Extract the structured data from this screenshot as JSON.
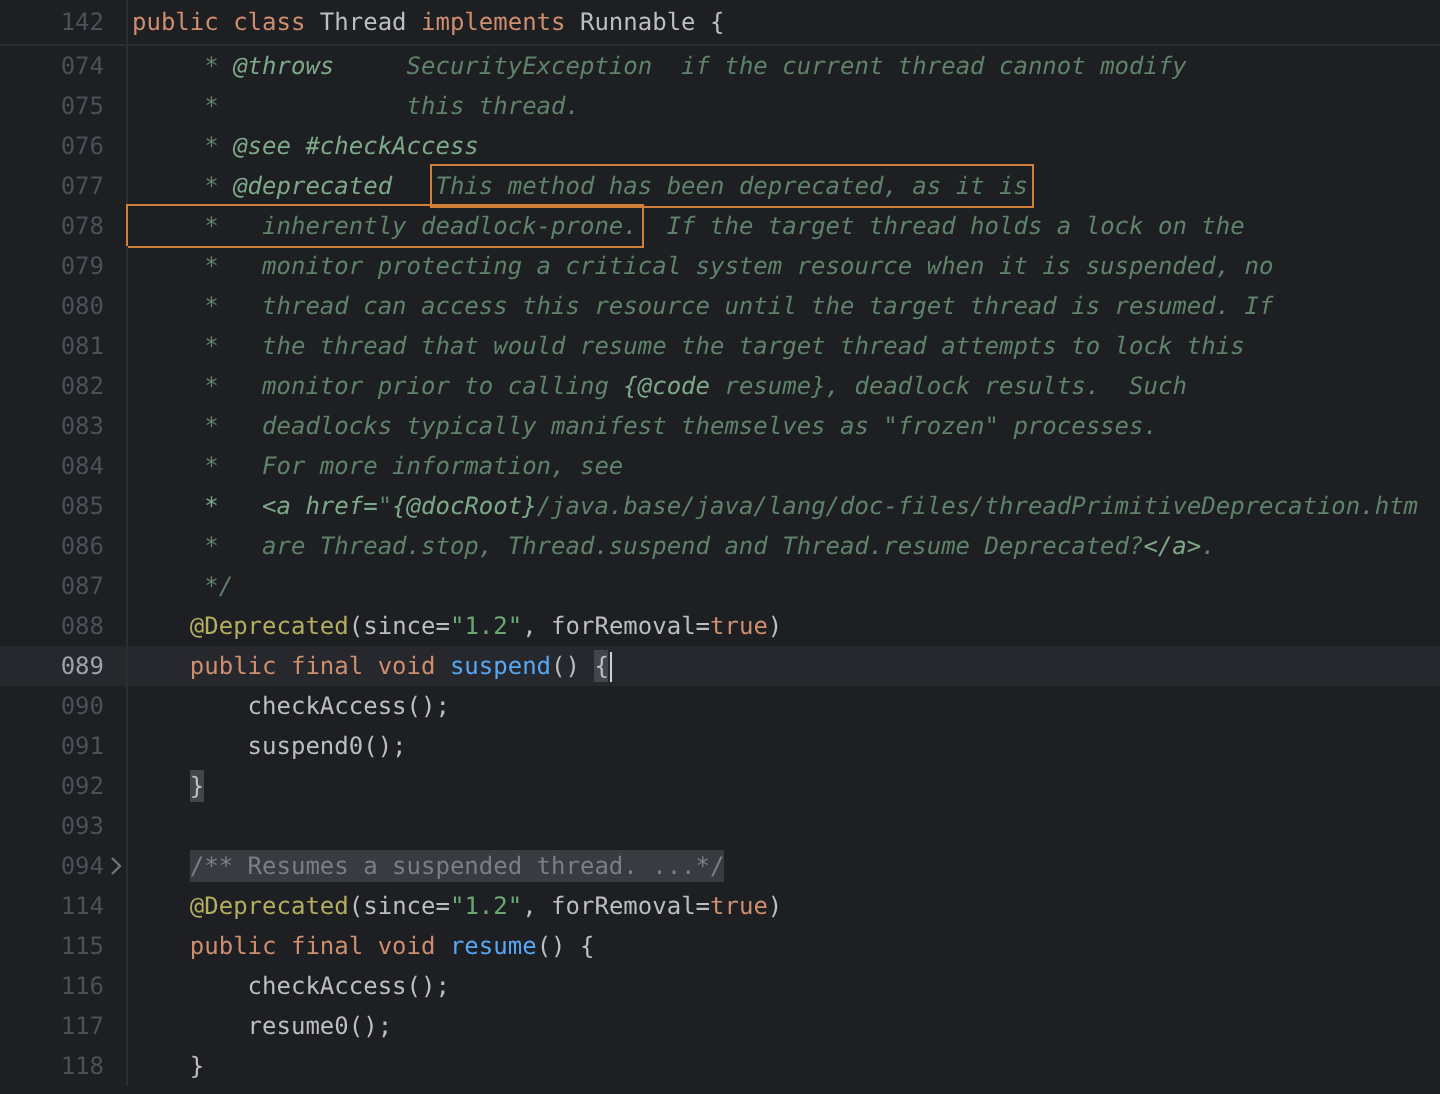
{
  "editor": {
    "sticky_line": {
      "number": "142",
      "tokens": [
        {
          "text": "public class ",
          "kind": "keyword"
        },
        {
          "text": "Thread ",
          "kind": "plain"
        },
        {
          "text": "implements ",
          "kind": "keyword"
        },
        {
          "text": "Runnable {",
          "kind": "plain"
        }
      ]
    },
    "lines": [
      {
        "number": "074",
        "current": false,
        "folded": false,
        "tokens": [
          {
            "text": "     * ",
            "kind": "comment"
          },
          {
            "text": "@throws",
            "kind": "doctag"
          },
          {
            "text": "     SecurityException  if the current thread cannot modify",
            "kind": "comment"
          }
        ]
      },
      {
        "number": "075",
        "current": false,
        "folded": false,
        "tokens": [
          {
            "text": "     *             this thread.",
            "kind": "comment"
          }
        ]
      },
      {
        "number": "076",
        "current": false,
        "folded": false,
        "tokens": [
          {
            "text": "     * ",
            "kind": "comment"
          },
          {
            "text": "@see #checkAccess",
            "kind": "doctag"
          }
        ]
      },
      {
        "number": "077",
        "current": false,
        "folded": false,
        "tokens": [
          {
            "text": "     * ",
            "kind": "comment"
          },
          {
            "text": "@deprecated   ",
            "kind": "doctag"
          },
          {
            "text": "This method has been deprecated, as it is",
            "kind": "comment",
            "boxed": true
          }
        ]
      },
      {
        "number": "078",
        "current": false,
        "folded": false,
        "tokens": [
          {
            "text": "     *   inherently deadlock-prone.",
            "kind": "comment",
            "boxed": true
          },
          {
            "text": "  If the target thread holds a lock on the",
            "kind": "comment"
          }
        ]
      },
      {
        "number": "079",
        "current": false,
        "folded": false,
        "tokens": [
          {
            "text": "     *   monitor protecting a critical system resource when it is suspended, no",
            "kind": "comment"
          }
        ]
      },
      {
        "number": "080",
        "current": false,
        "folded": false,
        "tokens": [
          {
            "text": "     *   thread can access this resource until the target thread is resumed. If",
            "kind": "comment"
          }
        ]
      },
      {
        "number": "081",
        "current": false,
        "folded": false,
        "tokens": [
          {
            "text": "     *   the thread that would resume the target thread attempts to lock this",
            "kind": "comment"
          }
        ]
      },
      {
        "number": "082",
        "current": false,
        "folded": false,
        "tokens": [
          {
            "text": "     *   monitor prior to calling ",
            "kind": "comment"
          },
          {
            "text": "{@code",
            "kind": "doctag"
          },
          {
            "text": " resume}, deadlock results.  Such",
            "kind": "comment"
          }
        ]
      },
      {
        "number": "083",
        "current": false,
        "folded": false,
        "tokens": [
          {
            "text": "     *   deadlocks typically manifest themselves as \"frozen\" processes.",
            "kind": "comment"
          }
        ]
      },
      {
        "number": "084",
        "current": false,
        "folded": false,
        "tokens": [
          {
            "text": "     *   For more information, see",
            "kind": "comment"
          }
        ]
      },
      {
        "number": "085",
        "current": false,
        "folded": false,
        "tokens": [
          {
            "text": "     *   <a href=",
            "kind": "doctag"
          },
          {
            "text": "\"",
            "kind": "comment"
          },
          {
            "text": "{@docRoot}",
            "kind": "doctag"
          },
          {
            "text": "/java.base/java/lang/doc-files/threadPrimitiveDeprecation.htm",
            "kind": "comment"
          }
        ]
      },
      {
        "number": "086",
        "current": false,
        "folded": false,
        "tokens": [
          {
            "text": "     *   are Thread.stop, Thread.suspend and Thread.resume Deprecated?",
            "kind": "comment"
          },
          {
            "text": "</a>",
            "kind": "doctag"
          },
          {
            "text": ".",
            "kind": "comment"
          }
        ]
      },
      {
        "number": "087",
        "current": false,
        "folded": false,
        "tokens": [
          {
            "text": "     */",
            "kind": "comment"
          }
        ]
      },
      {
        "number": "088",
        "current": false,
        "folded": false,
        "tokens": [
          {
            "text": "    @Deprecated",
            "kind": "annotation"
          },
          {
            "text": "(since=",
            "kind": "plain"
          },
          {
            "text": "\"1.2\"",
            "kind": "string"
          },
          {
            "text": ", forRemoval=",
            "kind": "plain"
          },
          {
            "text": "true",
            "kind": "keyword"
          },
          {
            "text": ")",
            "kind": "plain"
          }
        ]
      },
      {
        "number": "089",
        "current": true,
        "folded": false,
        "tokens": [
          {
            "text": "    public final void ",
            "kind": "keyword"
          },
          {
            "text": "suspend",
            "kind": "method"
          },
          {
            "text": "() ",
            "kind": "plain"
          },
          {
            "text": "{",
            "kind": "brace",
            "cursor": true
          }
        ]
      },
      {
        "number": "090",
        "current": false,
        "folded": false,
        "tokens": [
          {
            "text": "        checkAccess();",
            "kind": "plain"
          }
        ]
      },
      {
        "number": "091",
        "current": false,
        "folded": false,
        "tokens": [
          {
            "text": "        suspend0();",
            "kind": "plain"
          }
        ]
      },
      {
        "number": "092",
        "current": false,
        "folded": false,
        "tokens": [
          {
            "text": "    }",
            "kind": "brace"
          }
        ]
      },
      {
        "number": "093",
        "current": false,
        "folded": false
      },
      {
        "number": "094",
        "current": false,
        "folded": true,
        "tokens": [
          {
            "text": "    /** Resumes a suspended thread. ...*/",
            "kind": "folded"
          }
        ]
      },
      {
        "number": "114",
        "current": false,
        "folded": false,
        "tokens": [
          {
            "text": "    @Deprecated",
            "kind": "annotation"
          },
          {
            "text": "(since=",
            "kind": "plain"
          },
          {
            "text": "\"1.2\"",
            "kind": "string"
          },
          {
            "text": ", forRemoval=",
            "kind": "plain"
          },
          {
            "text": "true",
            "kind": "keyword"
          },
          {
            "text": ")",
            "kind": "plain"
          }
        ]
      },
      {
        "number": "115",
        "current": false,
        "folded": false,
        "tokens": [
          {
            "text": "    public final void ",
            "kind": "keyword"
          },
          {
            "text": "resume",
            "kind": "method"
          },
          {
            "text": "() {",
            "kind": "plain"
          }
        ]
      },
      {
        "number": "116",
        "current": false,
        "folded": false,
        "tokens": [
          {
            "text": "        checkAccess();",
            "kind": "plain"
          }
        ]
      },
      {
        "number": "117",
        "current": false,
        "folded": false,
        "tokens": [
          {
            "text": "        resume0();",
            "kind": "plain"
          }
        ]
      },
      {
        "number": "118",
        "current": false,
        "folded": false,
        "tokens": [
          {
            "text": "    }",
            "kind": "plain"
          }
        ]
      }
    ]
  }
}
